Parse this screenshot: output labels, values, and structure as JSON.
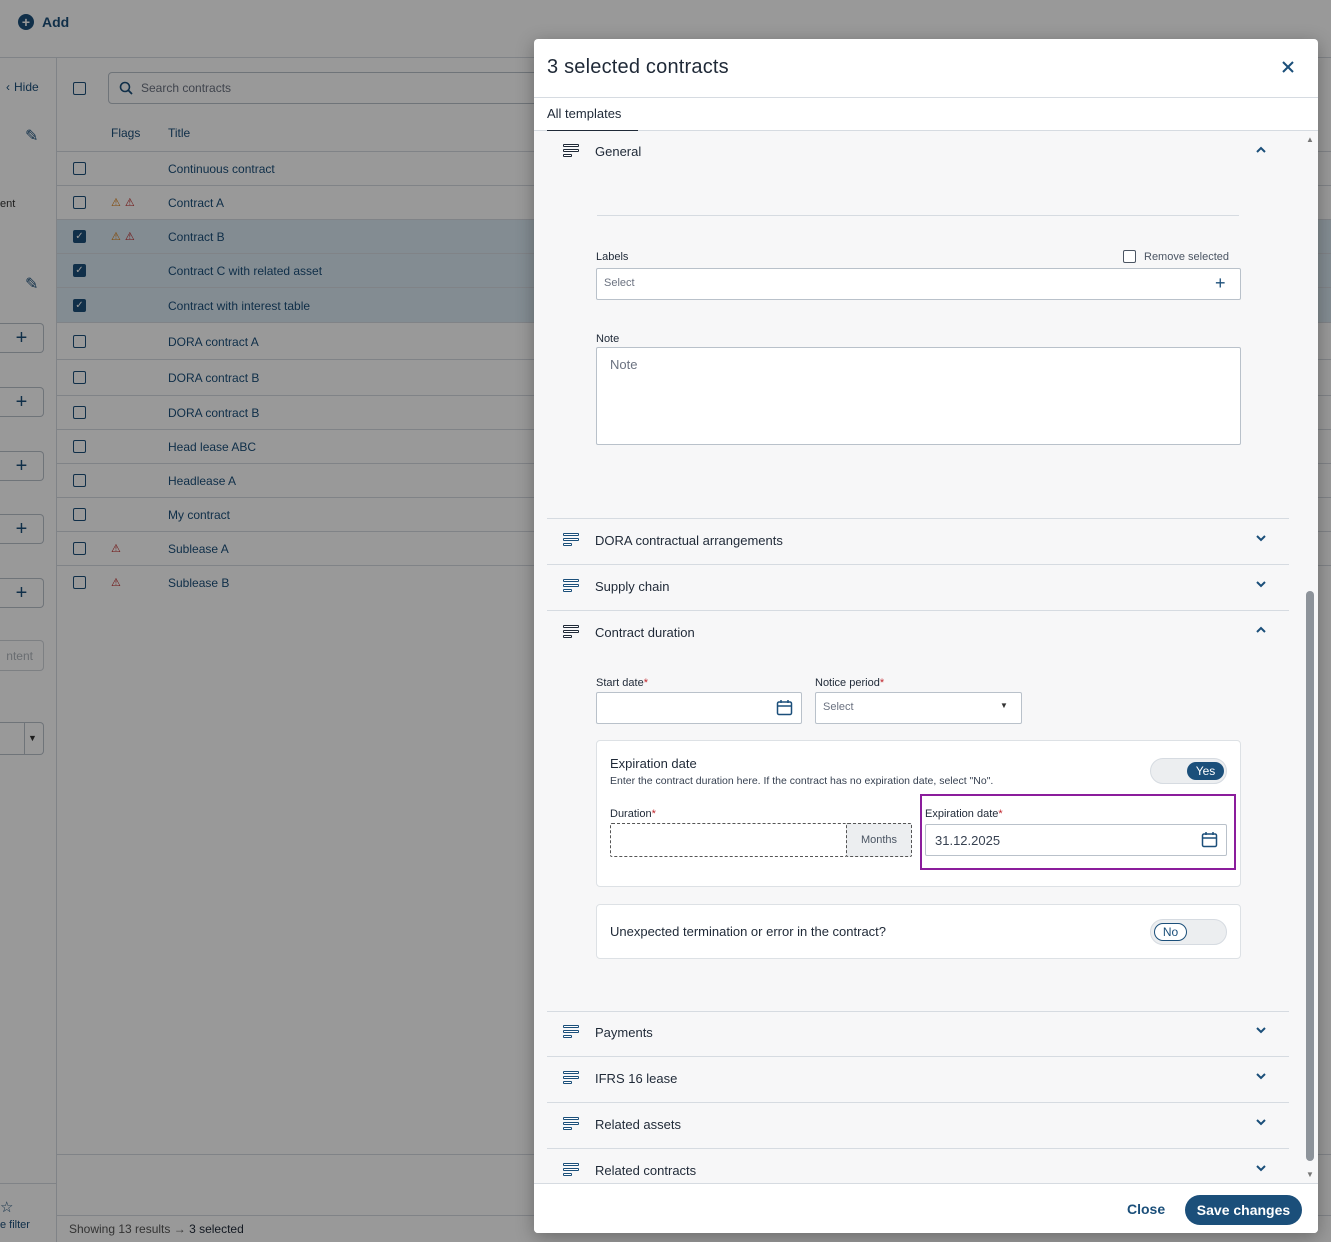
{
  "toolbar": {
    "add_label": "Add"
  },
  "left_panel": {
    "hide_label": "Hide",
    "partial_text": "ent",
    "content_placeholder": "ntent",
    "filter_label": "e filter"
  },
  "list": {
    "search_placeholder": "Search contracts",
    "columns": {
      "flags": "Flags",
      "title": "Title"
    },
    "rows": [
      {
        "title": "Continuous contract",
        "selected": false,
        "flags": ""
      },
      {
        "title": "Contract A",
        "selected": false,
        "flags": "ow"
      },
      {
        "title": "Contract B",
        "selected": true,
        "flags": "ow"
      },
      {
        "title": "Contract C with related asset",
        "selected": true,
        "flags": ""
      },
      {
        "title": "Contract with interest table",
        "selected": true,
        "flags": ""
      },
      {
        "title": "DORA contract A",
        "selected": false,
        "flags": ""
      },
      {
        "title": "DORA contract B",
        "selected": false,
        "flags": ""
      },
      {
        "title": "DORA contract B",
        "selected": false,
        "flags": ""
      },
      {
        "title": "Head lease ABC",
        "selected": false,
        "flags": ""
      },
      {
        "title": "Headlease A",
        "selected": false,
        "flags": ""
      },
      {
        "title": "My contract",
        "selected": false,
        "flags": ""
      },
      {
        "title": "Sublease A",
        "selected": false,
        "flags": "w"
      },
      {
        "title": "Sublease B",
        "selected": false,
        "flags": "w"
      }
    ],
    "status_showing": "Showing 13 results",
    "status_arrow": "→",
    "status_selected": "3 selected"
  },
  "modal": {
    "title": "3 selected contracts",
    "tab": "All templates",
    "general": {
      "title": "General",
      "labels_label": "Labels",
      "remove_selected": "Remove selected",
      "labels_placeholder": "Select",
      "note_label": "Note",
      "note_placeholder": "Note"
    },
    "sections": {
      "dora": "DORA contractual arrangements",
      "supply": "Supply chain",
      "duration": "Contract duration",
      "payments": "Payments",
      "ifrs": "IFRS 16 lease",
      "assets": "Related assets",
      "contracts": "Related contracts"
    },
    "duration": {
      "start_label": "Start date",
      "notice_label": "Notice period",
      "notice_placeholder": "Select",
      "required_mark": "*",
      "expiration_title": "Expiration date",
      "expiration_help": "Enter the contract duration here. If the contract has no expiration date, select \"No\".",
      "expiration_toggle": "Yes",
      "duration_label": "Duration",
      "duration_unit": "Months",
      "expiration_label": "Expiration date",
      "expiration_value": "31.12.2025",
      "termination_question": "Unexpected termination or error in the contract?",
      "termination_toggle": "No"
    },
    "footer": {
      "close": "Close",
      "save": "Save changes"
    }
  }
}
